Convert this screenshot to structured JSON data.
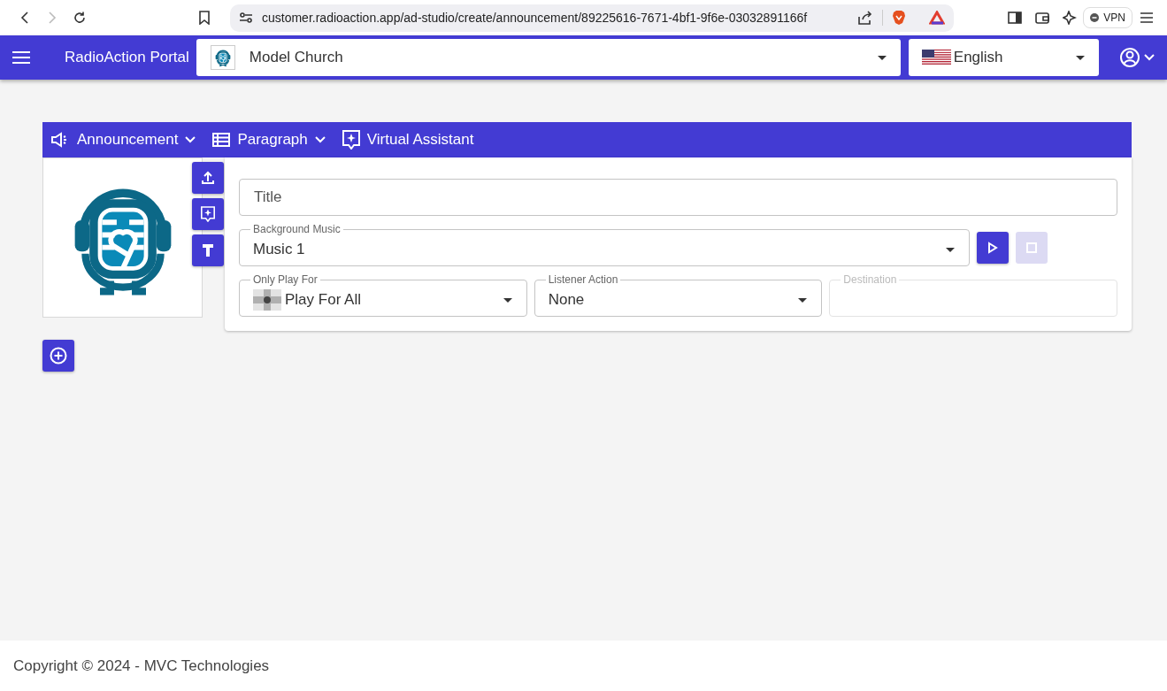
{
  "browser": {
    "url": "customer.radioaction.app/ad-studio/create/announcement/89225616-7671-4bf1-9f6e-03032891166f",
    "vpn_label": "VPN",
    "forward_disabled": true
  },
  "header": {
    "title": "RadioAction Portal",
    "organization": "Model Church",
    "language": "English"
  },
  "toolbar": [
    {
      "label": "Announcement",
      "expandable": true
    },
    {
      "label": "Paragraph",
      "expandable": true
    },
    {
      "label": "Virtual Assistant",
      "expandable": false
    }
  ],
  "form": {
    "title": {
      "placeholder": "Title"
    },
    "background_music": {
      "label": "Background Music",
      "value": "Music 1"
    },
    "play_button": {
      "disabled": false
    },
    "stop_button": {
      "disabled": true
    },
    "only_play_for": {
      "label": "Only Play For",
      "value": "Play For All"
    },
    "listener_action": {
      "label": "Listener Action",
      "value": "None"
    },
    "destination": {
      "label": "Destination",
      "disabled": true
    }
  },
  "footer": {
    "text": "Copyright © 2024 - MVC Technologies"
  }
}
